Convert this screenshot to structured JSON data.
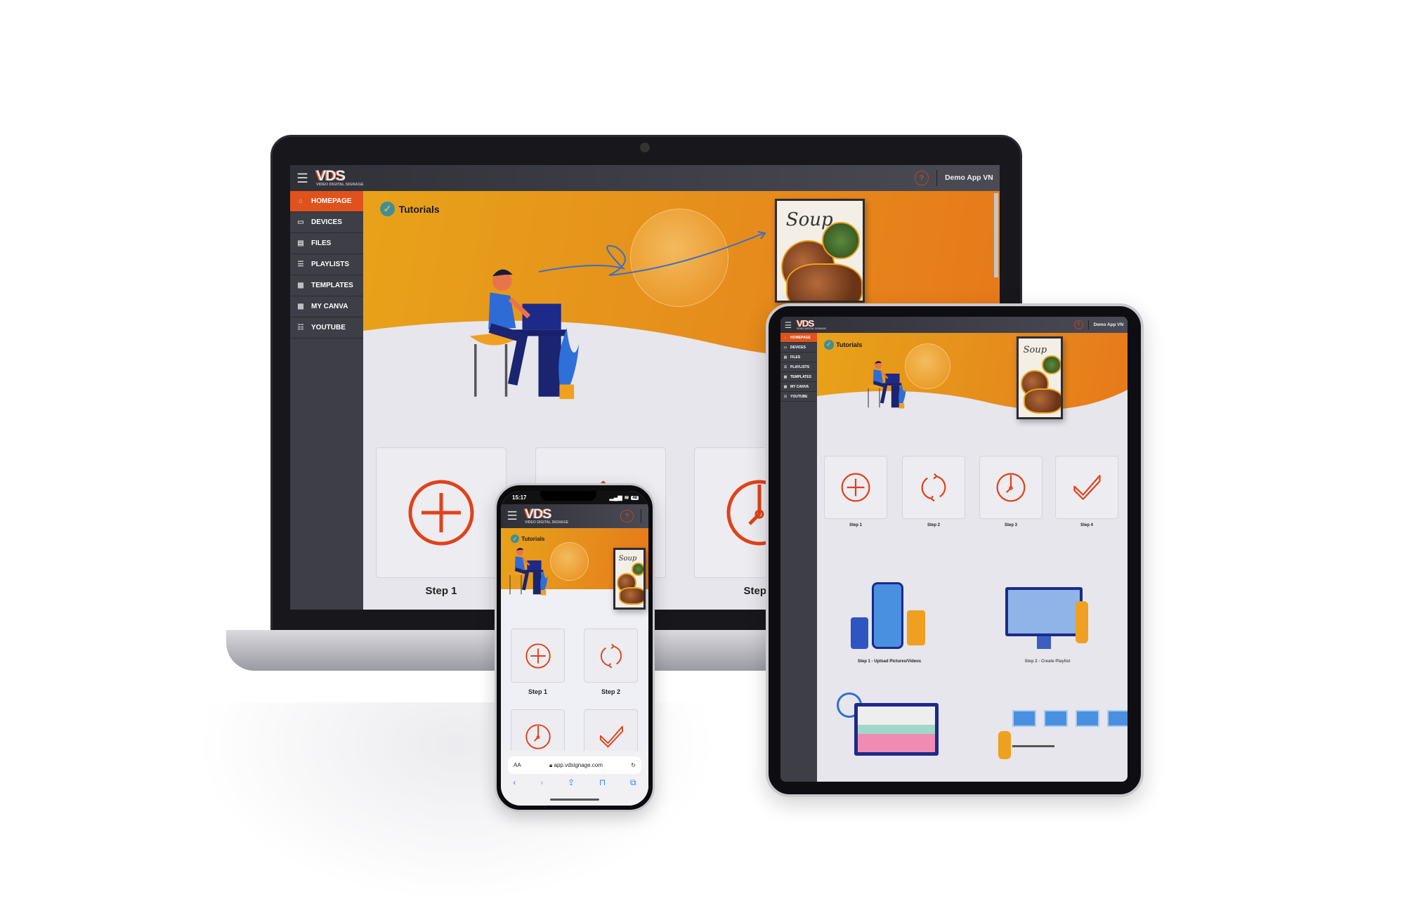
{
  "app": {
    "logo_mark": "VDS",
    "logo_subtitle": "VIDEO DIGITAL SIGNAGE",
    "help_label": "?",
    "user_name": "Demo App VN",
    "brand_color": "#e0521c",
    "accent_color": "#e8a219"
  },
  "sidebar": {
    "items": [
      {
        "label": "HOMEPAGE",
        "icon": "home-icon",
        "active": true
      },
      {
        "label": "DEVICES",
        "icon": "monitor-icon"
      },
      {
        "label": "FILES",
        "icon": "file-icon"
      },
      {
        "label": "PLAYLISTS",
        "icon": "list-icon"
      },
      {
        "label": "TEMPLATES",
        "icon": "template-icon"
      },
      {
        "label": "MY CANVA",
        "icon": "canva-icon"
      },
      {
        "label": "YOUTUBE",
        "icon": "youtube-icon"
      }
    ]
  },
  "main": {
    "title": "Tutorials",
    "poster_text": "Soup",
    "steps": [
      {
        "label": "Step 1",
        "icon": "plus-circle-icon"
      },
      {
        "label": "Step 2",
        "icon": "refresh-icon"
      },
      {
        "label": "Step 3",
        "icon": "clock-icon"
      },
      {
        "label": "Step 4",
        "icon": "check-icon"
      }
    ],
    "tutorials": [
      {
        "caption": "Step 1 - Upload Pictures/Videos"
      },
      {
        "caption": "Step 2 - Create Playlist"
      }
    ]
  },
  "phone": {
    "time": "15:17",
    "battery": "48",
    "text_size_label": "AA",
    "url": "app.vdsignage.com"
  }
}
